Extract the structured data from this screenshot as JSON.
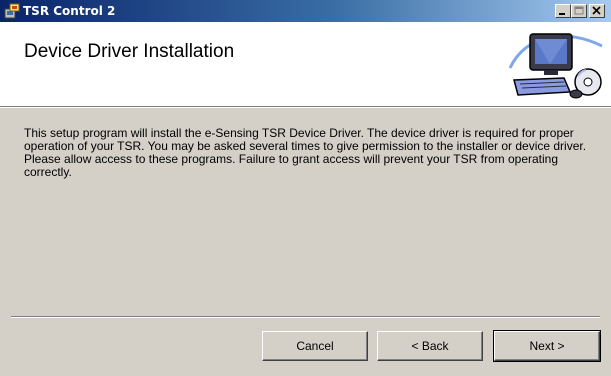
{
  "window": {
    "title": "TSR Control 2",
    "icon": "installer-icon",
    "controls": [
      "minimize-icon",
      "maximize-icon",
      "close-icon"
    ]
  },
  "header": {
    "title": "Device Driver Installation",
    "art": "computer-setup-icon"
  },
  "body": {
    "message": "This setup program will install the e-Sensing TSR Device Driver.  The device driver is required for proper operation of your TSR.  You may be asked several times to give permission to the installer or device driver.  Please allow access to these programs.  Failure to grant access will prevent your TSR from operating correctly."
  },
  "buttons": {
    "cancel": "Cancel",
    "back": "< Back",
    "next": "Next >"
  },
  "colors": {
    "titlebar_start": "#0a246a",
    "titlebar_end": "#a6caf0",
    "face": "#d4d0c8",
    "header_bg": "#ffffff"
  }
}
